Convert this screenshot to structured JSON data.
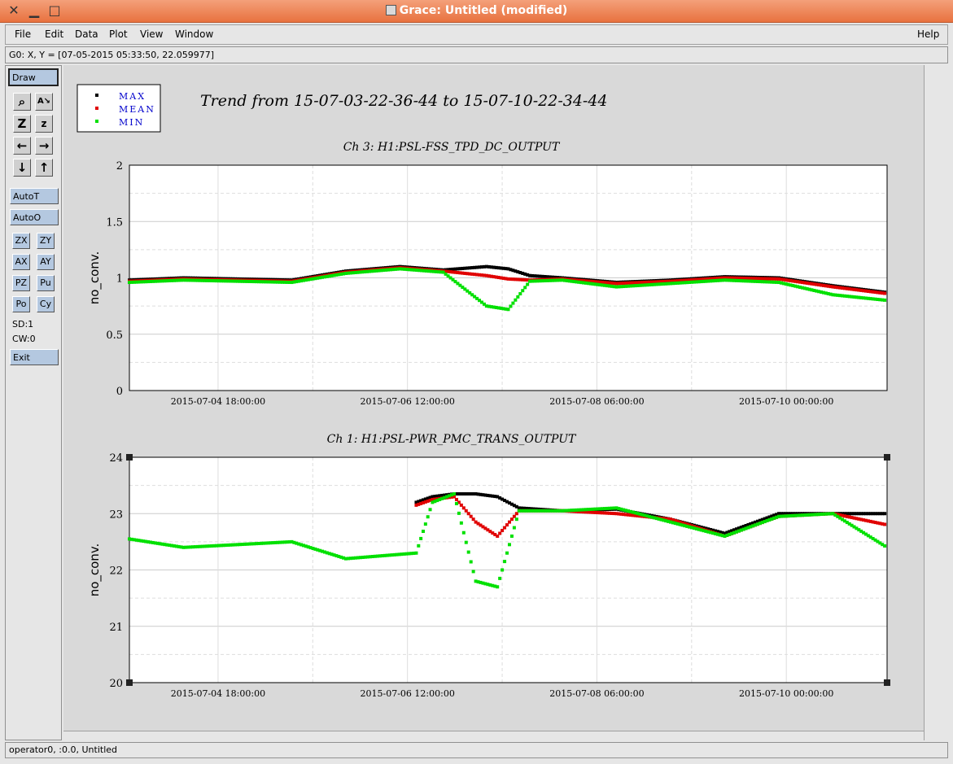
{
  "window": {
    "title": "Grace: Untitled (modified)"
  },
  "menus": [
    "File",
    "Edit",
    "Data",
    "Plot",
    "View",
    "Window"
  ],
  "help_menu": "Help",
  "locator": "G0: X, Y = [07-05-2015 05:33:50, 22.059977]",
  "toolbar": {
    "draw": "Draw",
    "autot": "AutoT",
    "autoo": "AutoO",
    "pair_buttons": [
      [
        "ZX",
        "ZY"
      ],
      [
        "AX",
        "AY"
      ],
      [
        "PZ",
        "Pu"
      ],
      [
        "Po",
        "Cy"
      ]
    ],
    "sd": "SD:1",
    "cw": "CW:0",
    "exit": "Exit"
  },
  "status": "operator0, :0.0, Untitled",
  "figure": {
    "main_title": "Trend from 15-07-03-22-36-44 to 15-07-10-22-34-44",
    "legend": [
      {
        "label": "MAX",
        "color": "#000000"
      },
      {
        "label": "MEAN",
        "color": "#e00000"
      },
      {
        "label": "MIN",
        "color": "#00e000"
      }
    ],
    "legend_text_color": "#0000cc"
  },
  "chart_data": [
    {
      "type": "scatter",
      "title": "Ch 3: H1:PSL-FSS_TPD_DC_OUTPUT",
      "ylabel": "no_conv.",
      "xlabel": "",
      "xlim": [
        "2015-07-03 22:36:44",
        "2015-07-10 22:34:44"
      ],
      "ylim": [
        0,
        2
      ],
      "yticks": [
        "0",
        "0.5",
        "1",
        "1.5",
        "2"
      ],
      "xticks": [
        "2015-07-04 18:00:00",
        "2015-07-06 12:00:00",
        "2015-07-08 06:00:00",
        "2015-07-10 00:00:00"
      ],
      "grid": true,
      "series": [
        {
          "name": "MAX",
          "color": "#000000",
          "x": [
            0,
            0.5,
            1,
            1.5,
            2,
            2.5,
            2.9,
            3.3,
            3.5,
            3.7,
            4,
            4.5,
            5,
            5.5,
            6,
            6.5,
            7
          ],
          "y": [
            0.98,
            1.0,
            0.99,
            0.98,
            1.06,
            1.1,
            1.07,
            1.1,
            1.08,
            1.02,
            1.0,
            0.96,
            0.98,
            1.01,
            1.0,
            0.93,
            0.87
          ]
        },
        {
          "name": "MEAN",
          "color": "#e00000",
          "x": [
            0,
            0.5,
            1,
            1.5,
            2,
            2.5,
            2.9,
            3.3,
            3.5,
            3.7,
            4,
            4.5,
            5,
            5.5,
            6,
            6.5,
            7
          ],
          "y": [
            0.97,
            0.99,
            0.98,
            0.97,
            1.05,
            1.09,
            1.06,
            1.02,
            0.99,
            0.98,
            0.99,
            0.95,
            0.97,
            1.0,
            0.99,
            0.92,
            0.86
          ]
        },
        {
          "name": "MIN",
          "color": "#00e000",
          "x": [
            0,
            0.5,
            1,
            1.5,
            2,
            2.5,
            2.9,
            3.3,
            3.5,
            3.7,
            4,
            4.5,
            5,
            5.5,
            6,
            6.5,
            7
          ],
          "y": [
            0.96,
            0.98,
            0.97,
            0.96,
            1.04,
            1.08,
            1.05,
            0.75,
            0.72,
            0.97,
            0.98,
            0.92,
            0.95,
            0.98,
            0.96,
            0.85,
            0.8
          ]
        }
      ]
    },
    {
      "type": "scatter",
      "title": "Ch 1: H1:PSL-PWR_PMC_TRANS_OUTPUT",
      "ylabel": "no_conv.",
      "xlabel": "",
      "xlim": [
        "2015-07-03 22:36:44",
        "2015-07-10 22:34:44"
      ],
      "ylim": [
        20,
        24
      ],
      "yticks": [
        "20",
        "21",
        "22",
        "23",
        "24"
      ],
      "xticks": [
        "2015-07-04 18:00:00",
        "2015-07-06 12:00:00",
        "2015-07-08 06:00:00",
        "2015-07-10 00:00:00"
      ],
      "grid": true,
      "series": [
        {
          "name": "MAX",
          "color": "#000000",
          "x": [
            2.65,
            2.8,
            3.0,
            3.2,
            3.4,
            3.6,
            4.0,
            4.5,
            5.0,
            5.5,
            6.0,
            6.5,
            7.0
          ],
          "y": [
            23.2,
            23.3,
            23.35,
            23.35,
            23.3,
            23.1,
            23.05,
            23.08,
            22.9,
            22.65,
            23.0,
            23.0,
            23.0
          ]
        },
        {
          "name": "MEAN",
          "color": "#e00000",
          "x": [
            2.65,
            2.8,
            3.0,
            3.2,
            3.4,
            3.6,
            4.0,
            4.5,
            5.0,
            5.5,
            6.0,
            6.5,
            7.0
          ],
          "y": [
            23.15,
            23.25,
            23.3,
            22.85,
            22.6,
            23.05,
            23.05,
            23.0,
            22.9,
            22.6,
            22.95,
            23.0,
            22.8
          ]
        },
        {
          "name": "MIN",
          "color": "#00e000",
          "x": [
            0,
            0.5,
            1,
            1.5,
            2,
            2.65,
            2.8,
            3.0,
            3.2,
            3.4,
            3.6,
            4.0,
            4.5,
            5.0,
            5.5,
            6.0,
            6.5,
            7.0
          ],
          "y": [
            22.55,
            22.4,
            22.45,
            22.5,
            22.2,
            22.3,
            23.2,
            23.35,
            21.8,
            21.7,
            23.05,
            23.05,
            23.1,
            22.85,
            22.6,
            22.95,
            23.0,
            22.4
          ]
        }
      ]
    }
  ]
}
